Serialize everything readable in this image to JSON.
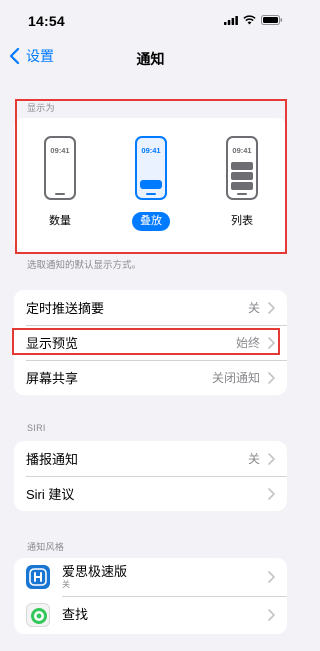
{
  "status_bar": {
    "time": "14:54"
  },
  "nav": {
    "back_label": "设置",
    "title": "通知"
  },
  "display_as": {
    "header": "显示为",
    "phone_time": "09:41",
    "options": [
      {
        "label": "数量",
        "selected": false
      },
      {
        "label": "叠放",
        "selected": true
      },
      {
        "label": "列表",
        "selected": false
      }
    ],
    "footer": "选取通知的默认显示方式。"
  },
  "settings_group1": [
    {
      "label": "定时推送摘要",
      "value": "关"
    },
    {
      "label": "显示预览",
      "value": "始终"
    },
    {
      "label": "屏幕共享",
      "value": "关闭通知"
    }
  ],
  "siri": {
    "header": "SIRI",
    "rows": [
      {
        "label": "播报通知",
        "value": "关"
      },
      {
        "label": "Siri 建议",
        "value": ""
      }
    ]
  },
  "notification_style": {
    "header": "通知风格",
    "apps": [
      {
        "name": "爱思极速版",
        "sub": "关",
        "icon": "aisi-app-icon"
      },
      {
        "name": "查找",
        "sub": "",
        "icon": "find-my-app-icon"
      }
    ]
  },
  "colors": {
    "accent": "#007aff",
    "highlight": "#e53935",
    "background": "#f2f2f7"
  }
}
